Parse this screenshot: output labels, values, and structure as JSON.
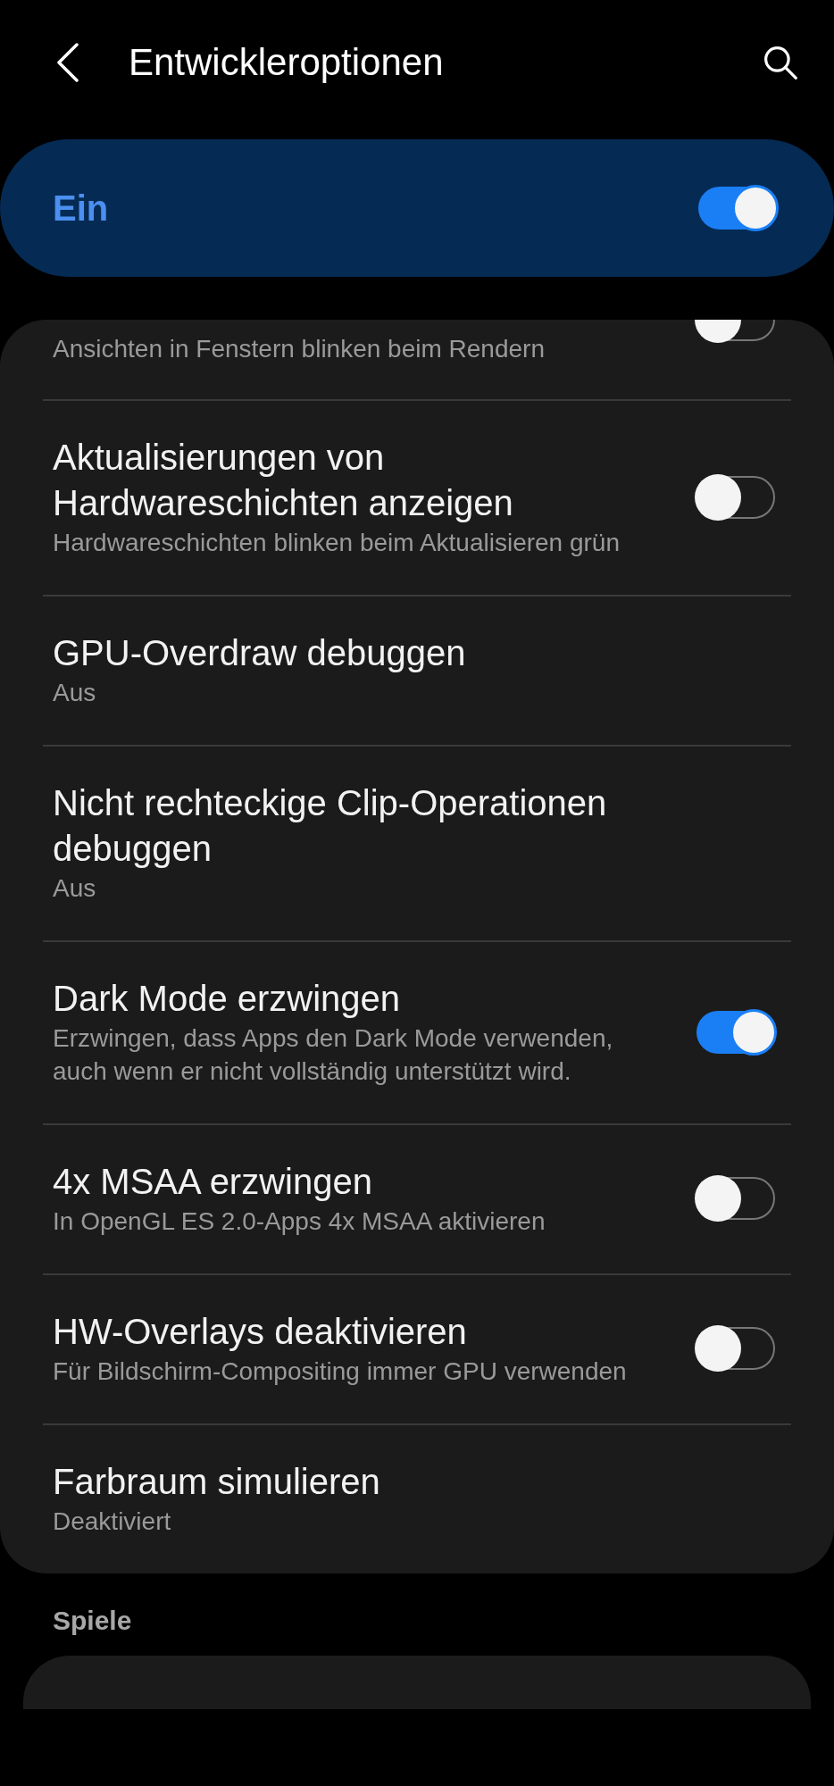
{
  "header": {
    "title": "Entwickleroptionen"
  },
  "master_switch": {
    "label": "Ein",
    "on": true
  },
  "settings": [
    {
      "kind": "partial",
      "subtitle": "Ansichten in Fenstern blinken beim Rendern",
      "on": false
    },
    {
      "kind": "switch",
      "title": "Aktualisierungen von Hardwareschichten anzeigen",
      "subtitle": "Hardwareschichten blinken beim Aktualisieren grün",
      "on": false
    },
    {
      "kind": "option",
      "title": "GPU-Overdraw debuggen",
      "subtitle": "Aus"
    },
    {
      "kind": "option",
      "title": "Nicht rechteckige Clip-Operationen debuggen",
      "subtitle": "Aus"
    },
    {
      "kind": "switch",
      "title": "Dark Mode erzwingen",
      "subtitle": "Erzwingen, dass Apps den Dark Mode verwenden, auch wenn er nicht vollständig unterstützt wird.",
      "on": true
    },
    {
      "kind": "switch",
      "title": "4x MSAA erzwingen",
      "subtitle": "In OpenGL ES 2.0-Apps 4x MSAA aktivieren",
      "on": false
    },
    {
      "kind": "switch",
      "title": "HW-Overlays deaktivieren",
      "subtitle": "Für Bildschirm-Compositing immer GPU verwenden",
      "on": false
    },
    {
      "kind": "option",
      "title": "Farbraum simulieren",
      "subtitle": "Deaktiviert"
    }
  ],
  "section": {
    "title": "Spiele"
  }
}
